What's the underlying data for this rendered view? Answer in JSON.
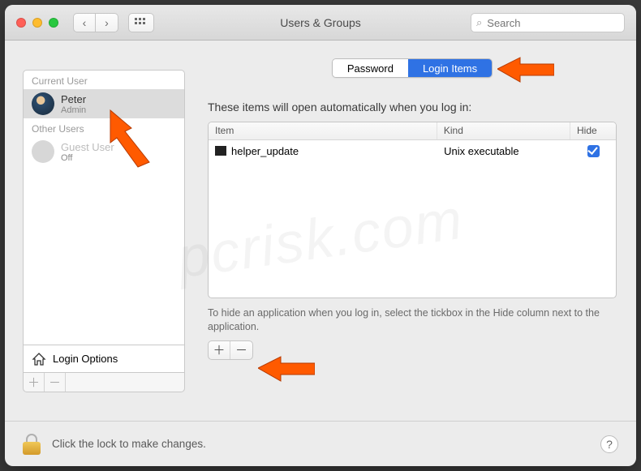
{
  "window": {
    "title": "Users & Groups"
  },
  "search": {
    "placeholder": "Search"
  },
  "sidebar": {
    "current_label": "Current User",
    "other_label": "Other Users",
    "users": [
      {
        "name": "Peter",
        "role": "Admin",
        "selected": true
      },
      {
        "name": "Guest User",
        "role": "Off",
        "selected": false
      }
    ],
    "login_options": "Login Options"
  },
  "tabs": {
    "password": "Password",
    "login_items": "Login Items"
  },
  "main": {
    "description": "These items will open automatically when you log in:",
    "columns": {
      "item": "Item",
      "kind": "Kind",
      "hide": "Hide"
    },
    "rows": [
      {
        "item": "helper_update",
        "kind": "Unix executable",
        "hide": true
      }
    ],
    "hint": "To hide an application when you log in, select the tickbox in the Hide column next to the application."
  },
  "footer": {
    "lock_text": "Click the lock to make changes.",
    "help": "?"
  },
  "icons": {
    "back": "‹",
    "fwd": "›",
    "plus": "＋",
    "minus": "－",
    "search": "⌕"
  },
  "watermark": "pcrisk.com"
}
